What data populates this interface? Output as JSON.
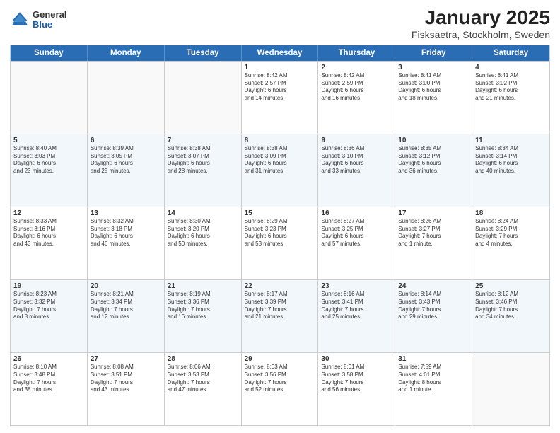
{
  "logo": {
    "general": "General",
    "blue": "Blue"
  },
  "title": "January 2025",
  "subtitle": "Fisksaetra, Stockholm, Sweden",
  "days": [
    "Sunday",
    "Monday",
    "Tuesday",
    "Wednesday",
    "Thursday",
    "Friday",
    "Saturday"
  ],
  "weeks": [
    [
      {
        "day": "",
        "info": ""
      },
      {
        "day": "",
        "info": ""
      },
      {
        "day": "",
        "info": ""
      },
      {
        "day": "1",
        "info": "Sunrise: 8:42 AM\nSunset: 2:57 PM\nDaylight: 6 hours\nand 14 minutes."
      },
      {
        "day": "2",
        "info": "Sunrise: 8:42 AM\nSunset: 2:59 PM\nDaylight: 6 hours\nand 16 minutes."
      },
      {
        "day": "3",
        "info": "Sunrise: 8:41 AM\nSunset: 3:00 PM\nDaylight: 6 hours\nand 18 minutes."
      },
      {
        "day": "4",
        "info": "Sunrise: 8:41 AM\nSunset: 3:02 PM\nDaylight: 6 hours\nand 21 minutes."
      }
    ],
    [
      {
        "day": "5",
        "info": "Sunrise: 8:40 AM\nSunset: 3:03 PM\nDaylight: 6 hours\nand 23 minutes."
      },
      {
        "day": "6",
        "info": "Sunrise: 8:39 AM\nSunset: 3:05 PM\nDaylight: 6 hours\nand 25 minutes."
      },
      {
        "day": "7",
        "info": "Sunrise: 8:38 AM\nSunset: 3:07 PM\nDaylight: 6 hours\nand 28 minutes."
      },
      {
        "day": "8",
        "info": "Sunrise: 8:38 AM\nSunset: 3:09 PM\nDaylight: 6 hours\nand 31 minutes."
      },
      {
        "day": "9",
        "info": "Sunrise: 8:36 AM\nSunset: 3:10 PM\nDaylight: 6 hours\nand 33 minutes."
      },
      {
        "day": "10",
        "info": "Sunrise: 8:35 AM\nSunset: 3:12 PM\nDaylight: 6 hours\nand 36 minutes."
      },
      {
        "day": "11",
        "info": "Sunrise: 8:34 AM\nSunset: 3:14 PM\nDaylight: 6 hours\nand 40 minutes."
      }
    ],
    [
      {
        "day": "12",
        "info": "Sunrise: 8:33 AM\nSunset: 3:16 PM\nDaylight: 6 hours\nand 43 minutes."
      },
      {
        "day": "13",
        "info": "Sunrise: 8:32 AM\nSunset: 3:18 PM\nDaylight: 6 hours\nand 46 minutes."
      },
      {
        "day": "14",
        "info": "Sunrise: 8:30 AM\nSunset: 3:20 PM\nDaylight: 6 hours\nand 50 minutes."
      },
      {
        "day": "15",
        "info": "Sunrise: 8:29 AM\nSunset: 3:23 PM\nDaylight: 6 hours\nand 53 minutes."
      },
      {
        "day": "16",
        "info": "Sunrise: 8:27 AM\nSunset: 3:25 PM\nDaylight: 6 hours\nand 57 minutes."
      },
      {
        "day": "17",
        "info": "Sunrise: 8:26 AM\nSunset: 3:27 PM\nDaylight: 7 hours\nand 1 minute."
      },
      {
        "day": "18",
        "info": "Sunrise: 8:24 AM\nSunset: 3:29 PM\nDaylight: 7 hours\nand 4 minutes."
      }
    ],
    [
      {
        "day": "19",
        "info": "Sunrise: 8:23 AM\nSunset: 3:32 PM\nDaylight: 7 hours\nand 8 minutes."
      },
      {
        "day": "20",
        "info": "Sunrise: 8:21 AM\nSunset: 3:34 PM\nDaylight: 7 hours\nand 12 minutes."
      },
      {
        "day": "21",
        "info": "Sunrise: 8:19 AM\nSunset: 3:36 PM\nDaylight: 7 hours\nand 16 minutes."
      },
      {
        "day": "22",
        "info": "Sunrise: 8:17 AM\nSunset: 3:39 PM\nDaylight: 7 hours\nand 21 minutes."
      },
      {
        "day": "23",
        "info": "Sunrise: 8:16 AM\nSunset: 3:41 PM\nDaylight: 7 hours\nand 25 minutes."
      },
      {
        "day": "24",
        "info": "Sunrise: 8:14 AM\nSunset: 3:43 PM\nDaylight: 7 hours\nand 29 minutes."
      },
      {
        "day": "25",
        "info": "Sunrise: 8:12 AM\nSunset: 3:46 PM\nDaylight: 7 hours\nand 34 minutes."
      }
    ],
    [
      {
        "day": "26",
        "info": "Sunrise: 8:10 AM\nSunset: 3:48 PM\nDaylight: 7 hours\nand 38 minutes."
      },
      {
        "day": "27",
        "info": "Sunrise: 8:08 AM\nSunset: 3:51 PM\nDaylight: 7 hours\nand 43 minutes."
      },
      {
        "day": "28",
        "info": "Sunrise: 8:06 AM\nSunset: 3:53 PM\nDaylight: 7 hours\nand 47 minutes."
      },
      {
        "day": "29",
        "info": "Sunrise: 8:03 AM\nSunset: 3:56 PM\nDaylight: 7 hours\nand 52 minutes."
      },
      {
        "day": "30",
        "info": "Sunrise: 8:01 AM\nSunset: 3:58 PM\nDaylight: 7 hours\nand 56 minutes."
      },
      {
        "day": "31",
        "info": "Sunrise: 7:59 AM\nSunset: 4:01 PM\nDaylight: 8 hours\nand 1 minute."
      },
      {
        "day": "",
        "info": ""
      }
    ]
  ]
}
